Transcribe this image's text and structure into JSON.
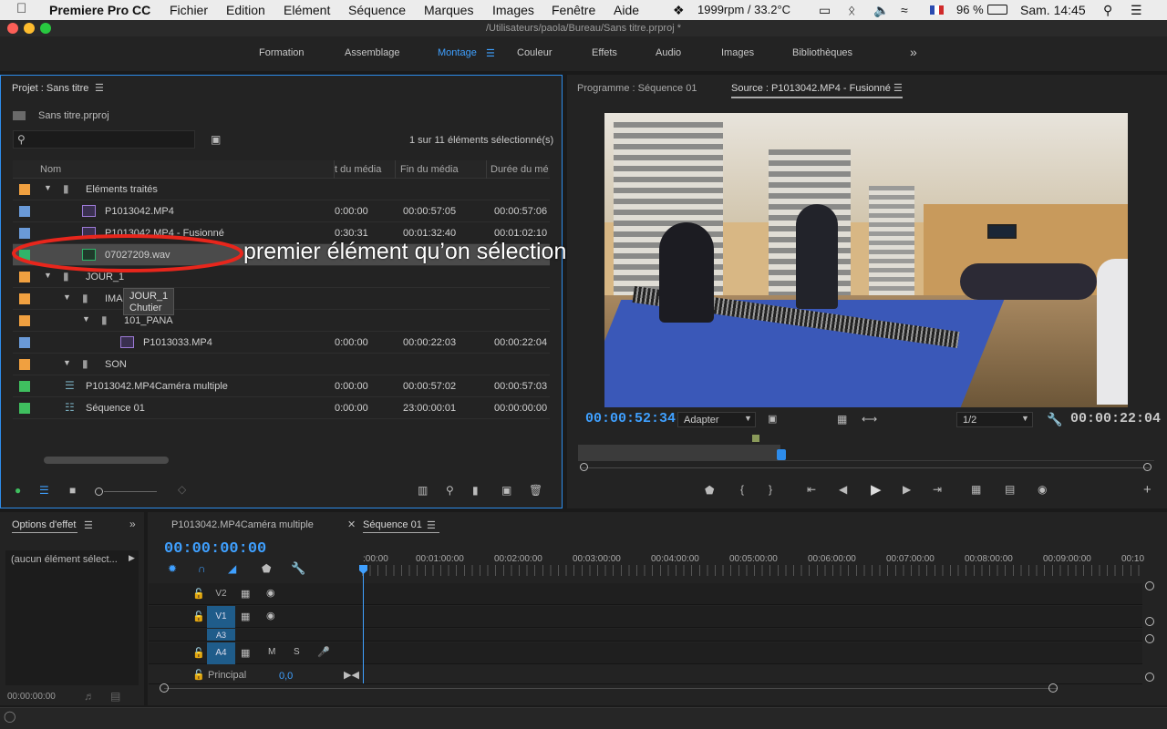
{
  "menubar": {
    "app": "Premiere Pro CC",
    "items": [
      "Fichier",
      "Edition",
      "Elément",
      "Séquence",
      "Marques",
      "Images",
      "Fenêtre",
      "Aide"
    ],
    "status": {
      "fan": "1999rpm / 33.2°C",
      "battery": "96 %",
      "clock": "Sam. 14:45"
    }
  },
  "window": {
    "title": "/Utilisateurs/paola/Bureau/Sans titre.prproj *"
  },
  "workspaces": {
    "items": [
      "Formation",
      "Assemblage",
      "Montage",
      "Couleur",
      "Effets",
      "Audio",
      "Images",
      "Bibliothèques"
    ],
    "active": "Montage",
    "more": "»"
  },
  "project": {
    "title": "Projet : Sans titre",
    "file": "Sans titre.prproj",
    "search_placeholder": "",
    "selection_count": "1 sur 11 éléments sélectionné(s)",
    "columns": {
      "name": "Nom",
      "start": "t du média",
      "end": "Fin du média",
      "duration": "Durée du mé"
    },
    "rows": [
      {
        "name": "Eléments traités",
        "color": "#f0a040",
        "start": "",
        "end": "",
        "duration": ""
      },
      {
        "name": "P1013042.MP4",
        "color": "#6a9ad8",
        "start": "0:00:00",
        "end": "00:00:57:05",
        "duration": "00:00:57:06"
      },
      {
        "name": "P1013042.MP4 - Fusionné",
        "color": "#6a9ad8",
        "start": "0:30:31",
        "end": "00:01:32:40",
        "duration": "00:01:02:10"
      },
      {
        "name": "07027209.wav",
        "color": "#2fb56a",
        "start": "",
        "end": "",
        "duration": ""
      },
      {
        "name": "JOUR_1",
        "color": "#f0a040",
        "start": "",
        "end": "",
        "duration": ""
      },
      {
        "name": "IMA",
        "color": "#f0a040",
        "start": "",
        "end": "",
        "duration": ""
      },
      {
        "name": "101_PANA",
        "color": "#f0a040",
        "start": "",
        "end": "",
        "duration": ""
      },
      {
        "name": "P1013033.MP4",
        "color": "#6a9ad8",
        "start": "0:00:00",
        "end": "00:00:22:03",
        "duration": "00:00:22:04"
      },
      {
        "name": "SON",
        "color": "#f0a040",
        "start": "",
        "end": "",
        "duration": ""
      },
      {
        "name": "P1013042.MP4Caméra multiple",
        "color": "#3fbf5f",
        "start": "0:00:00",
        "end": "00:00:57:02",
        "duration": "00:00:57:03"
      },
      {
        "name": "Séquence 01",
        "color": "#3fbf5f",
        "start": "0:00:00",
        "end": "23:00:00:01",
        "duration": "00:00:00:00"
      }
    ],
    "tooltip": {
      "line1": "JOUR_1",
      "line2": "Chutier"
    },
    "annotation": "premier élément qu’on sélectionne"
  },
  "monitor": {
    "program_tab": "Programme : Séquence 01",
    "source_tab": "Source : P1013042.MP4 - Fusionné",
    "timecode_in": "00:00:52:34",
    "fit": "Adapter",
    "resolution": "1/2",
    "duration": "00:00:22:04",
    "playhead_fraction": 0.1
  },
  "effect_options": {
    "title": "Options d'effet",
    "empty": "(aucun élément sélect...",
    "timecode": "00:00:00:00"
  },
  "timeline": {
    "tabs": [
      "P1013042.MP4Caméra multiple",
      "Séquence 01"
    ],
    "timecode": "00:00:00:00",
    "ruler": [
      ":00:00",
      "00:01:00:00",
      "00:02:00:00",
      "00:03:00:00",
      "00:04:00:00",
      "00:05:00:00",
      "00:06:00:00",
      "00:07:00:00",
      "00:08:00:00",
      "00:09:00:00",
      "00:10"
    ],
    "tracks": [
      {
        "id": "V2",
        "m": "",
        "s": ""
      },
      {
        "id": "V1",
        "m": "",
        "s": ""
      },
      {
        "id": "A3",
        "m": "M",
        "s": "S"
      },
      {
        "id": "A4",
        "m": "M",
        "s": "S"
      }
    ],
    "master": {
      "label": "Principal",
      "value": "0,0"
    }
  }
}
